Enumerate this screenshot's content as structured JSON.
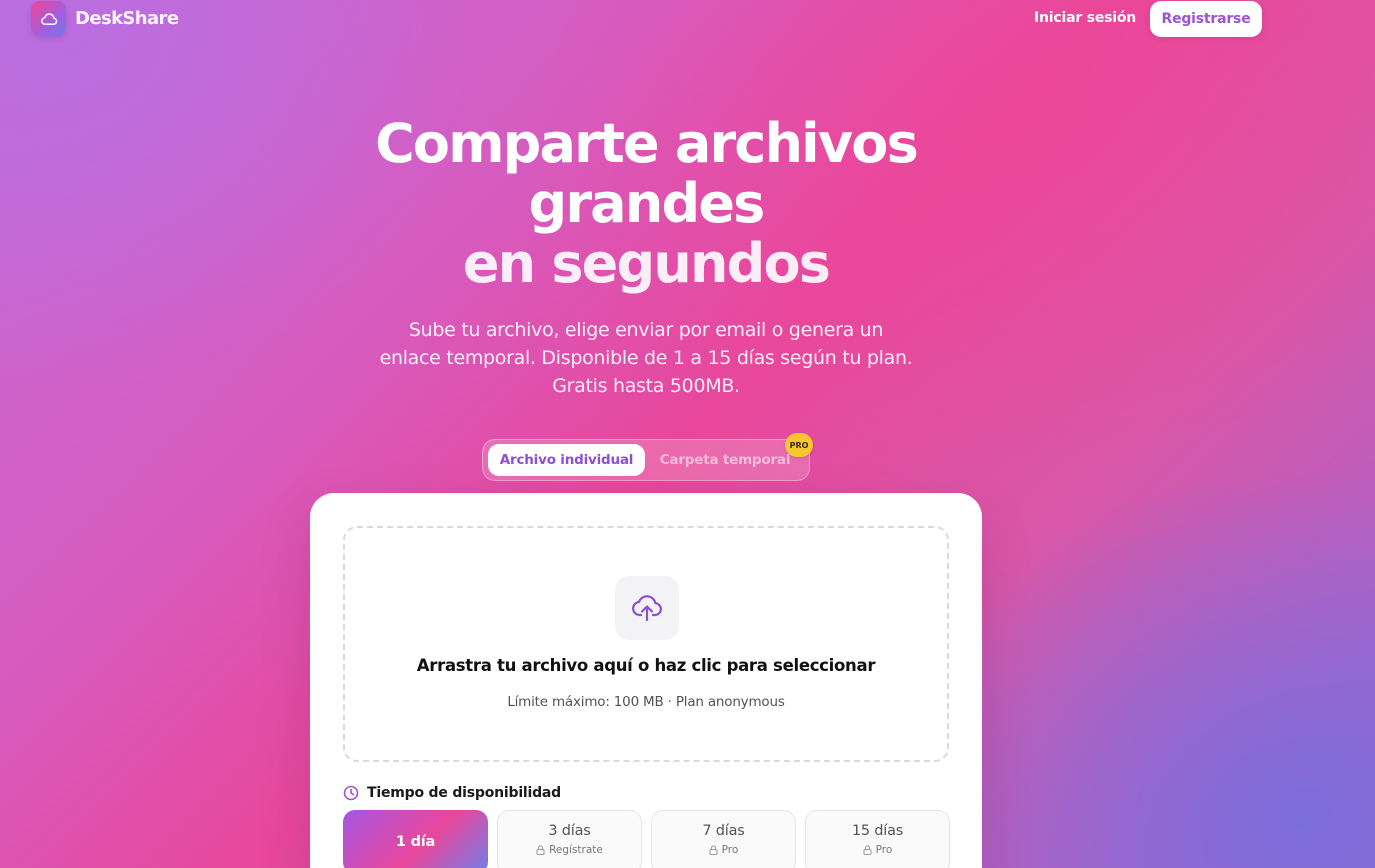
{
  "header": {
    "brand": "DeskShare",
    "login_label": "Iniciar sesión",
    "register_label": "Registrarse"
  },
  "hero": {
    "title_line1": "Comparte archivos",
    "title_line2": "grandes",
    "title_line3": "en segundos",
    "subtitle_line1": "Sube tu archivo, elige enviar por email o genera un",
    "subtitle_line2": "enlace temporal. Disponible de 1 a 15 días según tu plan.",
    "subtitle_line3": "Gratis hasta 500MB."
  },
  "mode_toggle": {
    "active_label": "Archivo individual",
    "inactive_label": "Carpeta temporal",
    "badge": "PRO"
  },
  "upload": {
    "title": "Arrastra tu archivo aquí o haz clic para seleccionar",
    "limit": "Límite máximo: 100 MB · Plan anonymous",
    "icon": "cloud-upload-icon"
  },
  "availability": {
    "label": "Tiempo de disponibilidad",
    "options": [
      {
        "label": "1 día",
        "sub": "",
        "selected": true
      },
      {
        "label": "3 días",
        "sub": "Regístrate",
        "selected": false
      },
      {
        "label": "7 días",
        "sub": "Pro",
        "selected": false
      },
      {
        "label": "15 días",
        "sub": "Pro",
        "selected": false
      }
    ]
  },
  "colors": {
    "accent_purple": "#9b54d6",
    "pro_badge": "#f7c531",
    "gradient_pink": "#e9479b"
  }
}
